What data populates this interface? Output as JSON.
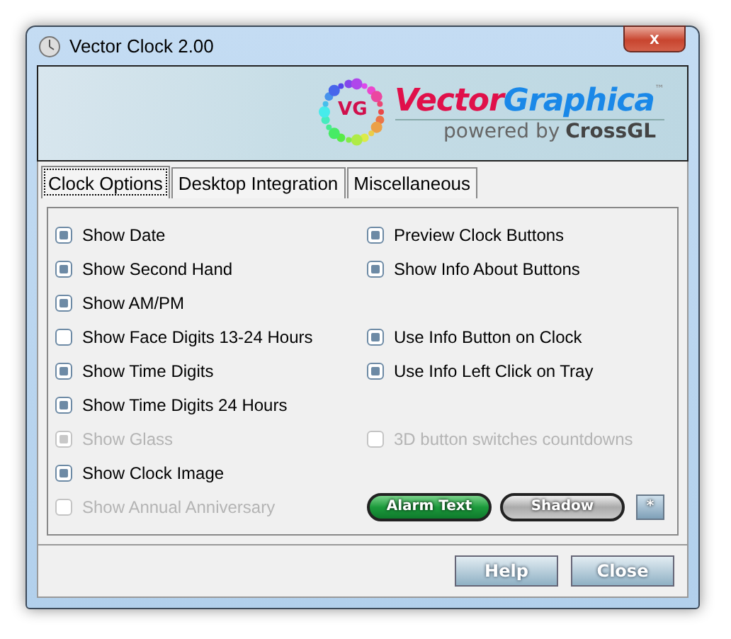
{
  "window": {
    "title": "Vector Clock 2.00",
    "close": "x"
  },
  "banner": {
    "mark": "VG",
    "brand_1": "Vector",
    "brand_2": "Graphica",
    "tm": "™",
    "tagline": "powered by",
    "tagline_brand": "CrossGL"
  },
  "tabs": [
    {
      "label": "Clock Options",
      "selected": true
    },
    {
      "label": "Desktop Integration",
      "selected": false
    },
    {
      "label": "Miscellaneous",
      "selected": false
    }
  ],
  "rows": [
    {
      "left": {
        "label": "Show Date",
        "checked": true,
        "disabled": false
      },
      "right": {
        "label": "Preview Clock Buttons",
        "checked": true,
        "disabled": false
      }
    },
    {
      "left": {
        "label": "Show Second Hand",
        "checked": true,
        "disabled": false
      },
      "right": {
        "label": "Show Info About Buttons",
        "checked": true,
        "disabled": false
      }
    },
    {
      "left": {
        "label": "Show AM/PM",
        "checked": true,
        "disabled": false
      }
    },
    {
      "left": {
        "label": "Show Face Digits 13-24 Hours",
        "checked": false,
        "disabled": false
      },
      "right": {
        "label": "Use Info Button on Clock",
        "checked": true,
        "disabled": false
      }
    },
    {
      "left": {
        "label": "Show Time Digits",
        "checked": true,
        "disabled": false
      },
      "right": {
        "label": "Use Info Left Click on Tray",
        "checked": true,
        "disabled": false
      }
    },
    {
      "left": {
        "label": "Show Time Digits 24 Hours",
        "checked": true,
        "disabled": false
      }
    },
    {
      "left": {
        "label": "Show Glass",
        "checked": true,
        "disabled": true
      },
      "right": {
        "label": "3D button switches countdowns",
        "checked": false,
        "disabled": true
      }
    },
    {
      "left": {
        "label": "Show Clock Image",
        "checked": true,
        "disabled": false
      }
    },
    {
      "left": {
        "label": "Show Annual Anniversary",
        "checked": false,
        "disabled": true
      }
    }
  ],
  "style_buttons": [
    {
      "label": "Alarm Text",
      "kind": "green"
    },
    {
      "label": "Shadow",
      "kind": "grey"
    },
    {
      "label": "*",
      "kind": "small"
    }
  ],
  "buttons": [
    "Help",
    "Close"
  ]
}
